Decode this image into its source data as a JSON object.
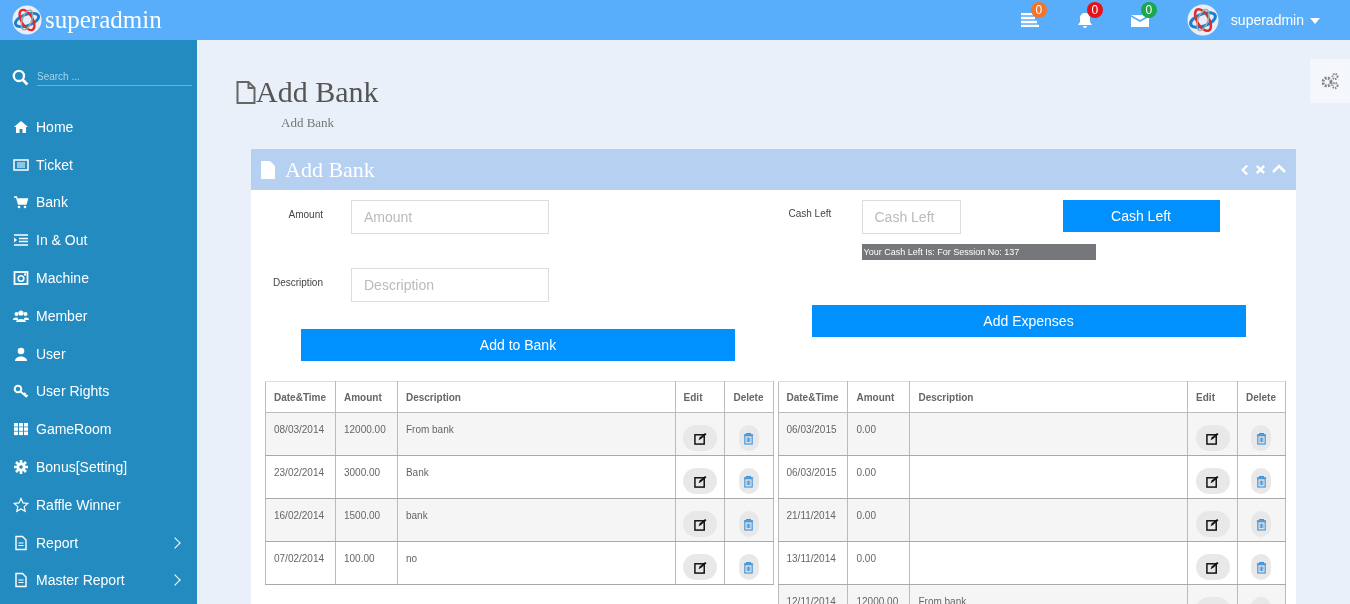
{
  "header": {
    "brand": "superadmin",
    "notifications": [
      {
        "kind": "tasks",
        "count": "0",
        "color": "#f5732b"
      },
      {
        "kind": "bell",
        "count": "0",
        "color": "#e8111a"
      },
      {
        "kind": "mail",
        "count": "0",
        "color": "#1aa84a"
      }
    ],
    "user": "superadmin"
  },
  "sidebar": {
    "search": {
      "placeholder": "Search ..."
    },
    "items": [
      {
        "label": "Home",
        "submenu": false
      },
      {
        "label": "Ticket",
        "submenu": false
      },
      {
        "label": "Bank",
        "submenu": false
      },
      {
        "label": "In & Out",
        "submenu": false
      },
      {
        "label": "Machine",
        "submenu": false
      },
      {
        "label": "Member",
        "submenu": false
      },
      {
        "label": "User",
        "submenu": false
      },
      {
        "label": "User Rights",
        "submenu": false
      },
      {
        "label": "GameRoom",
        "submenu": false
      },
      {
        "label": "Bonus[Setting]",
        "submenu": false
      },
      {
        "label": "Raffle Winner",
        "submenu": false
      },
      {
        "label": "Report",
        "submenu": true
      },
      {
        "label": "Master Report",
        "submenu": true
      }
    ]
  },
  "page": {
    "title": "Add Bank",
    "breadcrumb": "Add Bank"
  },
  "panel": {
    "title": "Add Bank",
    "form": {
      "amount_label": "Amount",
      "amount_placeholder": "Amount",
      "description_label": "Description",
      "description_placeholder": "Description",
      "add_button": "Add to Bank",
      "cash_label": "Cash Left",
      "cash_placeholder": "Cash Left",
      "cash_button": "Cash Left",
      "cash_message": "Your Cash Left Is: For Session No: 137",
      "expenses_button": "Add Expenses"
    },
    "tables": [
      {
        "columns": [
          "Date&Time",
          "Amount",
          "Description",
          "Edit",
          "Delete"
        ],
        "rows": [
          {
            "date": "08/03/2014",
            "amount": "12000.00",
            "description": "From bank"
          },
          {
            "date": "23/02/2014",
            "amount": "3000.00",
            "description": "Bank"
          },
          {
            "date": "16/02/2014",
            "amount": "1500.00",
            "description": "bank"
          },
          {
            "date": "07/02/2014",
            "amount": "100.00",
            "description": "no"
          }
        ]
      },
      {
        "columns": [
          "Date&Time",
          "Amount",
          "Description",
          "Edit",
          "Delete"
        ],
        "rows": [
          {
            "date": "06/03/2015",
            "amount": "0.00"
          },
          {
            "date": "06/03/2015",
            "amount": "0.00"
          },
          {
            "date": "21/11/2014",
            "amount": "0.00"
          },
          {
            "date": "13/11/2014",
            "amount": "0.00"
          },
          {
            "date": "12/11/2014",
            "amount": "12000.00",
            "description": "From bank"
          }
        ]
      }
    ]
  }
}
